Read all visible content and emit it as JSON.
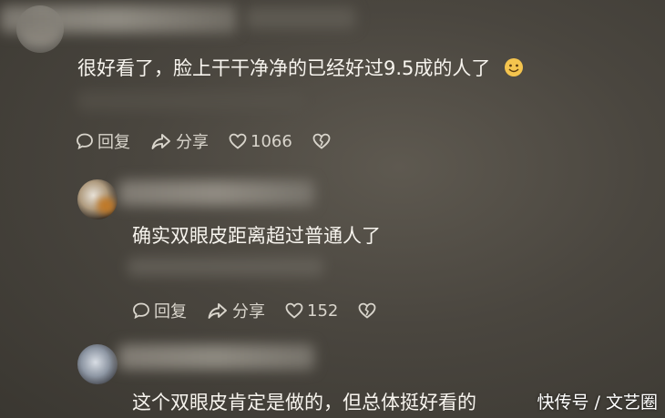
{
  "comment1": {
    "text": "很好看了，脸上干干净净的已经好过9.5成的人了",
    "emoji": "smile-emoji",
    "reply_label": "回复",
    "share_label": "分享",
    "likes": "1066"
  },
  "comment2": {
    "text": "确实双眼皮距离超过普通人了",
    "reply_label": "回复",
    "share_label": "分享",
    "likes": "152"
  },
  "comment3": {
    "text": "这个双眼皮肯定是做的，但总体挺好看的"
  },
  "watermark": "快传号 / 文艺圈"
}
